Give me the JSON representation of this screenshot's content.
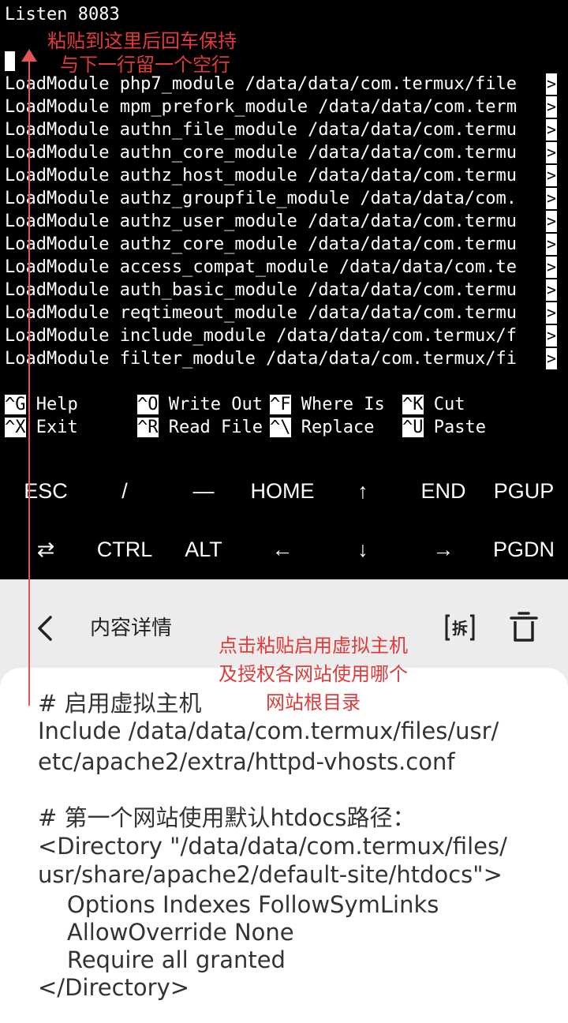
{
  "terminal": {
    "listen_line": "Listen 8083",
    "module_lines": [
      "LoadModule php7_module /data/data/com.termux/file",
      "LoadModule mpm_prefork_module /data/data/com.term",
      "LoadModule authn_file_module /data/data/com.termu",
      "LoadModule authn_core_module /data/data/com.termu",
      "LoadModule authz_host_module /data/data/com.termu",
      "LoadModule authz_groupfile_module /data/data/com.",
      "LoadModule authz_user_module /data/data/com.termu",
      "LoadModule authz_core_module /data/data/com.termu",
      "LoadModule access_compat_module /data/data/com.te",
      "LoadModule auth_basic_module /data/data/com.termu",
      "LoadModule reqtimeout_module /data/data/com.termu",
      "LoadModule include_module /data/data/com.termux/f",
      "LoadModule filter_module /data/data/com.termux/fi"
    ],
    "overflow_mark": ">",
    "shortcuts": [
      {
        "key": "^G",
        "label": " Help"
      },
      {
        "key": "^O",
        "label": " Write Out"
      },
      {
        "key": "^F",
        "label": " Where Is"
      },
      {
        "key": "^K",
        "label": " Cut"
      },
      {
        "key": "^X",
        "label": " Exit"
      },
      {
        "key": "^R",
        "label": " Read File"
      },
      {
        "key": "^\\",
        "label": " Replace"
      },
      {
        "key": "^U",
        "label": " Paste"
      }
    ]
  },
  "extra_keys": {
    "row1": [
      "ESC",
      "/",
      "—",
      "HOME",
      "↑",
      "END",
      "PGUP"
    ],
    "row2": [
      "⇄",
      "CTRL",
      "ALT",
      "←",
      "↓",
      "→",
      "PGDN"
    ]
  },
  "clipboard": {
    "title": "内容详情",
    "lines": [
      "# 启用虚拟主机",
      "Include /data/data/com.termux/files/usr/",
      "etc/apache2/extra/httpd-vhosts.conf",
      "",
      "# 第一个网站使用默认htdocs路径：",
      "<Directory \"/data/data/com.termux/files/",
      "usr/share/apache2/default-site/htdocs\">",
      "    Options Indexes FollowSymLinks",
      "    AllowOverride None",
      "    Require all granted",
      "</Directory>"
    ]
  },
  "annotations": {
    "paste_hint_1": "粘贴到这里后回车保持",
    "paste_hint_2": "与下一行留一个空行",
    "click_hint_1": "点击粘贴启用虚拟主机",
    "click_hint_2": "及授权各网站使用哪个",
    "click_hint_3": "网站根目录"
  },
  "colors": {
    "terminal_bg": "#000000",
    "terminal_fg": "#ffffff",
    "panel_bg": "#ececec",
    "card_bg": "#ffffff",
    "annotation": "#e03a3a"
  }
}
